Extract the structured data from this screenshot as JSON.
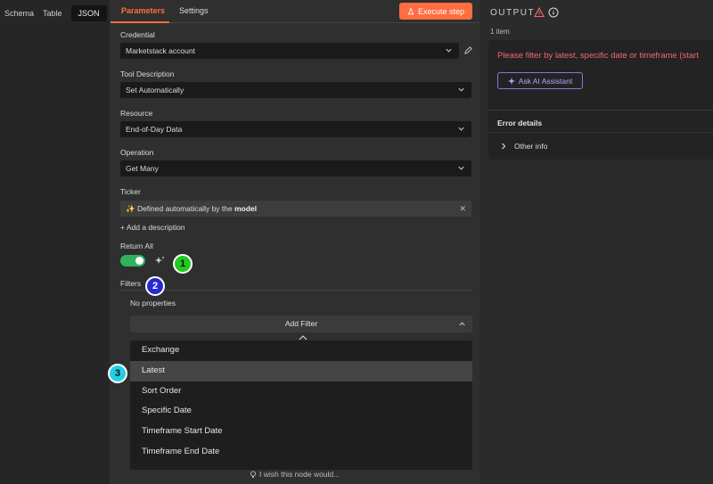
{
  "input_panel": {
    "tabs": [
      "Schema",
      "Table",
      "JSON"
    ],
    "active_tab": "JSON"
  },
  "params_panel": {
    "tabs": {
      "parameters": "Parameters",
      "settings": "Settings"
    },
    "execute_label": "Execute step",
    "credential": {
      "label": "Credential",
      "value": "Marketstack account"
    },
    "tool_description": {
      "label": "Tool Description",
      "value": "Set Automatically"
    },
    "resource": {
      "label": "Resource",
      "value": "End-of-Day Data"
    },
    "operation": {
      "label": "Operation",
      "value": "Get Many"
    },
    "ticker": {
      "label": "Ticker",
      "prefix": "✨ Defined automatically by the ",
      "bold": "model"
    },
    "add_description": "+ Add a description",
    "return_all": {
      "label": "Return All",
      "enabled": true
    },
    "filters": {
      "label": "Filters",
      "empty_text": "No properties",
      "add_label": "Add Filter",
      "options": [
        "Exchange",
        "Latest",
        "Sort Order",
        "Specific Date",
        "Timeframe Start Date",
        "Timeframe End Date"
      ],
      "highlighted": "Latest"
    },
    "wish_text": "I wish this node would..."
  },
  "markers": [
    "1",
    "2",
    "3"
  ],
  "output": {
    "title": "OUTPUT",
    "item_count": "1 item",
    "error_message": "Please filter by latest, specific date or timeframe (start",
    "ask_ai_label": "Ask AI Assistant",
    "error_details_label": "Error details",
    "other_info_label": "Other info"
  },
  "colors": {
    "accent": "#ff6d40",
    "toggle_on": "#2db35d",
    "error": "#f0696f",
    "ai_purple": "#8a75e0"
  }
}
